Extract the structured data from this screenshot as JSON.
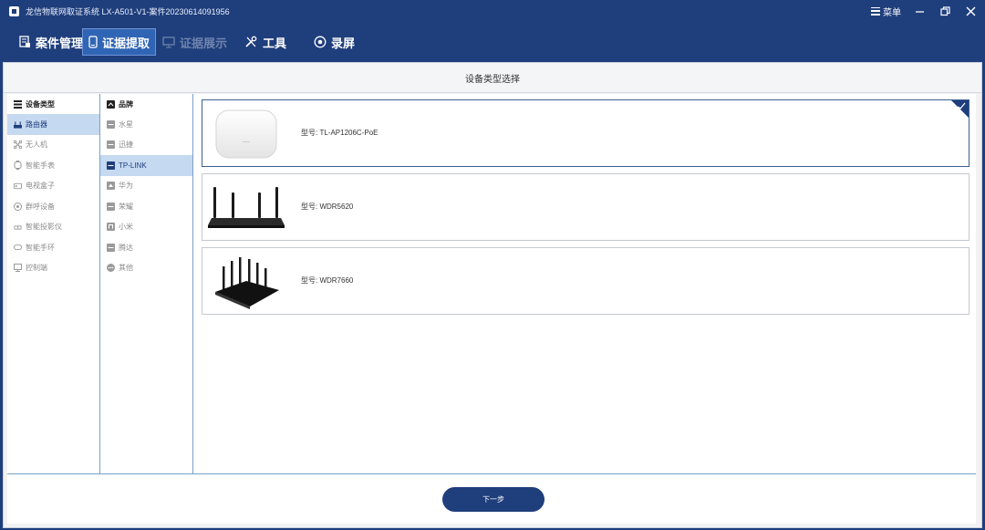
{
  "window": {
    "title": "龙信物联网取证系统 LX-A501-V1-案件20230614091956",
    "menu_label": "菜单"
  },
  "toolbar": {
    "tabs": [
      {
        "label": "案件管理",
        "icon": "case-icon",
        "state": "normal"
      },
      {
        "label": "证据提取",
        "icon": "phone-icon",
        "state": "active"
      },
      {
        "label": "证据展示",
        "icon": "display-icon",
        "state": "disabled"
      },
      {
        "label": "工具",
        "icon": "tools-icon",
        "state": "normal"
      },
      {
        "label": "录屏",
        "icon": "record-icon",
        "state": "normal"
      }
    ]
  },
  "panel": {
    "header": "设备类型选择"
  },
  "device_types": {
    "header": "设备类型",
    "items": [
      {
        "label": "路由器",
        "icon": "router-icon",
        "selected": true
      },
      {
        "label": "无人机",
        "icon": "drone-icon",
        "selected": false
      },
      {
        "label": "智能手表",
        "icon": "watch-icon",
        "selected": false
      },
      {
        "label": "电视盒子",
        "icon": "tvbox-icon",
        "selected": false
      },
      {
        "label": "群呼设备",
        "icon": "broadcast-icon",
        "selected": false
      },
      {
        "label": "智能投影仪",
        "icon": "projector-icon",
        "selected": false
      },
      {
        "label": "智能手环",
        "icon": "band-icon",
        "selected": false
      },
      {
        "label": "控制端",
        "icon": "controller-icon",
        "selected": false
      }
    ]
  },
  "brands": {
    "header": "品牌",
    "items": [
      {
        "label": "水星",
        "icon": "brand-logo-icon",
        "selected": false
      },
      {
        "label": "迅捷",
        "icon": "brand-logo-icon",
        "selected": false
      },
      {
        "label": "TP-LINK",
        "icon": "brand-logo-icon",
        "selected": true
      },
      {
        "label": "华为",
        "icon": "brand-logo-icon",
        "selected": false
      },
      {
        "label": "荣耀",
        "icon": "brand-logo-icon",
        "selected": false
      },
      {
        "label": "小米",
        "icon": "brand-logo-icon",
        "selected": false
      },
      {
        "label": "腾达",
        "icon": "brand-logo-icon",
        "selected": false
      },
      {
        "label": "其他",
        "icon": "other-icon",
        "selected": false
      }
    ]
  },
  "models": [
    {
      "label": "型号: TL-AP1206C-PoE",
      "image": "ceiling-ap-image",
      "selected": true
    },
    {
      "label": "型号: WDR5620",
      "image": "router-4-antenna-image",
      "selected": false
    },
    {
      "label": "型号: WDR7660",
      "image": "router-6-antenna-image",
      "selected": false
    }
  ],
  "footer": {
    "next_label": "下一步"
  },
  "colors": {
    "brand": "#1f3e7c",
    "active_tab": "#3065b5",
    "selected_row": "#c5d9f0",
    "background": "#f2f2f2"
  }
}
